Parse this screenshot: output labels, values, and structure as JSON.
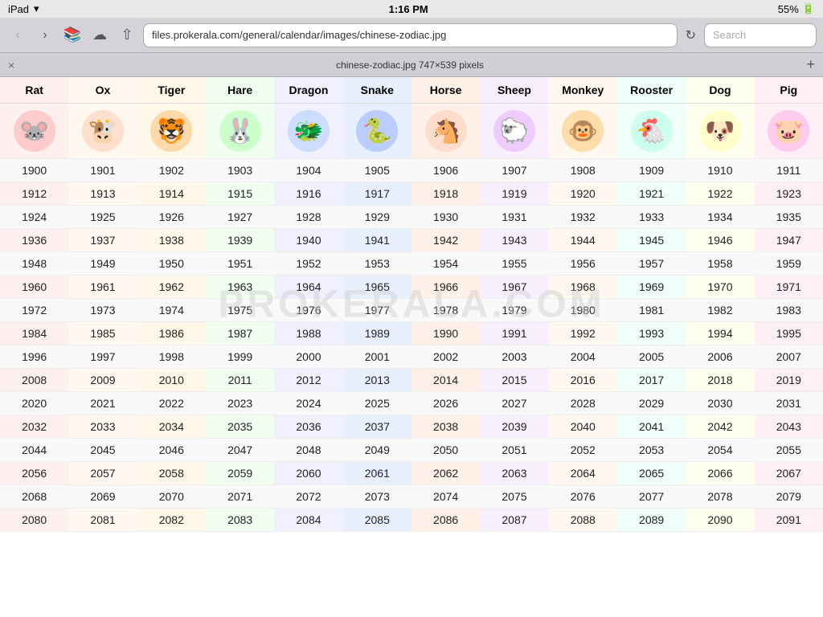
{
  "statusBar": {
    "device": "iPad",
    "wifi": "WiFi",
    "time": "1:16 PM",
    "battery": "55%"
  },
  "browser": {
    "url": "files.prokerala.com/general/calendar/images/chinese-zodiac.jpg",
    "search_placeholder": "Search",
    "refresh_title": "Refresh"
  },
  "tab": {
    "title": "chinese-zodiac.jpg 747×539 pixels",
    "close_label": "×",
    "new_label": "+"
  },
  "zodiac": {
    "watermark": "PROKERALA.COM",
    "animals": [
      {
        "name": "Rat",
        "emoji": "🐭",
        "bgClass": "animal-rat",
        "colClass": "col-rat"
      },
      {
        "name": "Ox",
        "emoji": "🐮",
        "bgClass": "animal-ox",
        "colClass": "col-ox"
      },
      {
        "name": "Tiger",
        "emoji": "🐯",
        "bgClass": "animal-tiger",
        "colClass": "col-tiger"
      },
      {
        "name": "Hare",
        "emoji": "🐰",
        "bgClass": "animal-hare",
        "colClass": "col-hare"
      },
      {
        "name": "Dragon",
        "emoji": "🐲",
        "bgClass": "animal-dragon",
        "colClass": "col-dragon"
      },
      {
        "name": "Snake",
        "emoji": "🐍",
        "bgClass": "animal-snake",
        "colClass": "col-snake"
      },
      {
        "name": "Horse",
        "emoji": "🐴",
        "bgClass": "animal-horse",
        "colClass": "col-horse"
      },
      {
        "name": "Sheep",
        "emoji": "🐑",
        "bgClass": "animal-sheep",
        "colClass": "col-sheep"
      },
      {
        "name": "Monkey",
        "emoji": "🐵",
        "bgClass": "animal-monkey",
        "colClass": "col-monkey"
      },
      {
        "name": "Rooster",
        "emoji": "🐔",
        "bgClass": "animal-rooster",
        "colClass": "col-rooster"
      },
      {
        "name": "Dog",
        "emoji": "🐶",
        "bgClass": "animal-dog",
        "colClass": "col-dog"
      },
      {
        "name": "Pig",
        "emoji": "🐷",
        "bgClass": "animal-pig",
        "colClass": "col-pig"
      }
    ],
    "years": [
      [
        1900,
        1901,
        1902,
        1903,
        1904,
        1905,
        1906,
        1907,
        1908,
        1909,
        1910,
        1911
      ],
      [
        1912,
        1913,
        1914,
        1915,
        1916,
        1917,
        1918,
        1919,
        1920,
        1921,
        1922,
        1923
      ],
      [
        1924,
        1925,
        1926,
        1927,
        1928,
        1929,
        1930,
        1931,
        1932,
        1933,
        1934,
        1935
      ],
      [
        1936,
        1937,
        1938,
        1939,
        1940,
        1941,
        1942,
        1943,
        1944,
        1945,
        1946,
        1947
      ],
      [
        1948,
        1949,
        1950,
        1951,
        1952,
        1953,
        1954,
        1955,
        1956,
        1957,
        1958,
        1959
      ],
      [
        1960,
        1961,
        1962,
        1963,
        1964,
        1965,
        1966,
        1967,
        1968,
        1969,
        1970,
        1971
      ],
      [
        1972,
        1973,
        1974,
        1975,
        1976,
        1977,
        1978,
        1979,
        1980,
        1981,
        1982,
        1983
      ],
      [
        1984,
        1985,
        1986,
        1987,
        1988,
        1989,
        1990,
        1991,
        1992,
        1993,
        1994,
        1995
      ],
      [
        1996,
        1997,
        1998,
        1999,
        2000,
        2001,
        2002,
        2003,
        2004,
        2005,
        2006,
        2007
      ],
      [
        2008,
        2009,
        2010,
        2011,
        2012,
        2013,
        2014,
        2015,
        2016,
        2017,
        2018,
        2019
      ],
      [
        2020,
        2021,
        2022,
        2023,
        2024,
        2025,
        2026,
        2027,
        2028,
        2029,
        2030,
        2031
      ],
      [
        2032,
        2033,
        2034,
        2035,
        2036,
        2037,
        2038,
        2039,
        2040,
        2041,
        2042,
        2043
      ],
      [
        2044,
        2045,
        2046,
        2047,
        2048,
        2049,
        2050,
        2051,
        2052,
        2053,
        2054,
        2055
      ],
      [
        2056,
        2057,
        2058,
        2059,
        2060,
        2061,
        2062,
        2063,
        2064,
        2065,
        2066,
        2067
      ],
      [
        2068,
        2069,
        2070,
        2071,
        2072,
        2073,
        2074,
        2075,
        2076,
        2077,
        2078,
        2079
      ],
      [
        2080,
        2081,
        2082,
        2083,
        2084,
        2085,
        2086,
        2087,
        2088,
        2089,
        2090,
        2091
      ]
    ]
  }
}
